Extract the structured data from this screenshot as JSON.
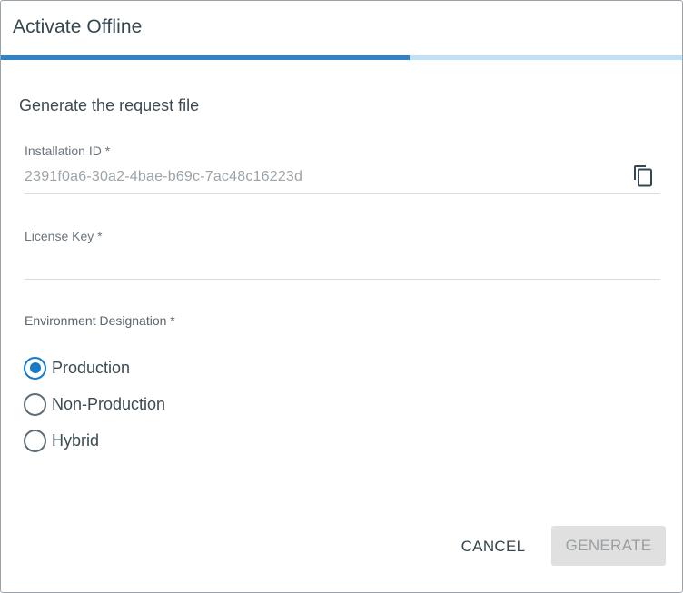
{
  "dialog": {
    "title": "Activate Offline",
    "progress_fraction": 0.6,
    "colors": {
      "accent": "#2f82c7",
      "track": "#bfe0f5",
      "radio": "#1779c7"
    }
  },
  "step": {
    "heading": "Generate the request file"
  },
  "installation": {
    "label": "Installation ID *",
    "value": "2391f0a6-30a2-4bae-b69c-7ac48c16223d",
    "copy_icon": "copy-icon"
  },
  "license": {
    "label": "License Key *",
    "value": "",
    "placeholder": ""
  },
  "environment": {
    "label": "Environment Designation *",
    "options": [
      {
        "label": "Production",
        "checked": true
      },
      {
        "label": "Non-Production",
        "checked": false
      },
      {
        "label": "Hybrid",
        "checked": false
      }
    ]
  },
  "actions": {
    "cancel_label": "CANCEL",
    "generate_label": "GENERATE",
    "generate_enabled": false
  }
}
